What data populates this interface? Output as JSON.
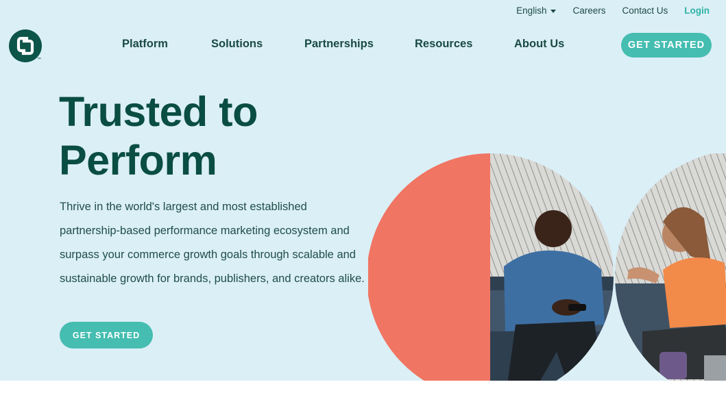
{
  "utility_nav": {
    "language": "English",
    "careers": "Careers",
    "contact": "Contact Us",
    "login": "Login"
  },
  "logo": {
    "tm": "™",
    "icon": "cj-logo-icon"
  },
  "nav": {
    "items": [
      "Platform",
      "Solutions",
      "Partnerships",
      "Resources",
      "About Us"
    ],
    "cta": "GET STARTED"
  },
  "hero": {
    "headline_line1": "Trusted to",
    "headline_line2": "Perform",
    "description": "Thrive in the world's largest and most established partnership-based performance marketing ecosystem and surpass your commerce growth goals through scalable and sustainable growth for brands, publishers, and creators alike.",
    "cta": "GET STARTED"
  },
  "colors": {
    "hero_background": "#dbeff7",
    "accent": "#45bdb1",
    "brand_dark": "#0a4d42",
    "coral": "#f07562",
    "login": "#2fb3a5"
  }
}
